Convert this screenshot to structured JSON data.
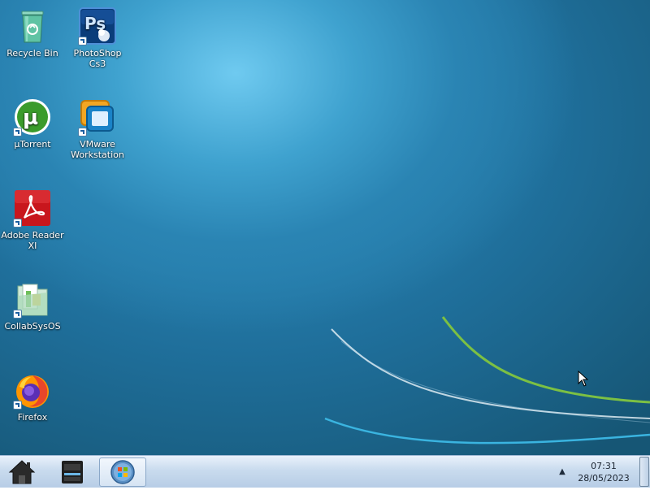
{
  "desktop": {
    "icons": [
      {
        "label": "Recycle Bin",
        "icon": "recycle-bin-icon"
      },
      {
        "label": "PhotoShop Cs3",
        "icon": "photoshop-icon"
      },
      {
        "label": "µTorrent",
        "icon": "utorrent-icon"
      },
      {
        "label": "VMware Workstation",
        "icon": "vmware-icon"
      },
      {
        "label": "Adobe Reader XI",
        "icon": "adobe-reader-icon"
      },
      {
        "label": "CollabSysOS",
        "icon": "folder-icon"
      },
      {
        "label": "Firefox",
        "icon": "firefox-icon"
      }
    ],
    "wallpaper_colors": {
      "highlight": "#6fcaf0",
      "base": "#1f6f9b",
      "swoosh_green": "#7cc043",
      "swoosh_white": "#e8f2f8",
      "swoosh_cyan": "#3ab4e0"
    }
  },
  "taskbar": {
    "home_icon": "home-icon",
    "files_icon": "file-manager-icon",
    "start_icon": "windows-start-orb-icon",
    "tray_arrow": "▲",
    "time": "07:31",
    "date": "28/05/2023"
  }
}
